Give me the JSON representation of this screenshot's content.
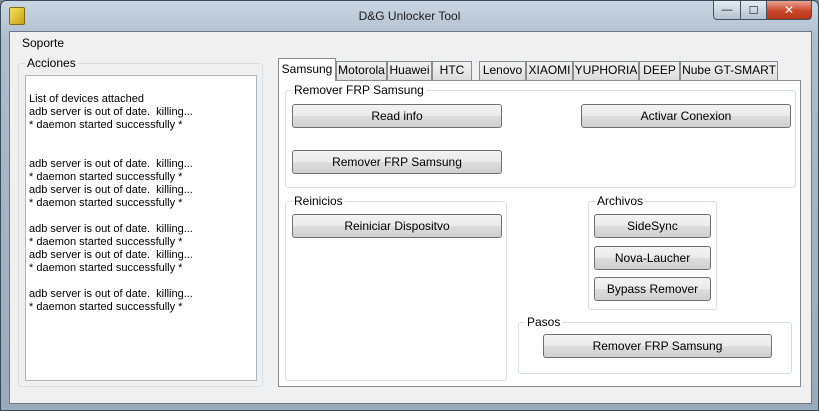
{
  "window": {
    "title": "D&G Unlocker Tool",
    "minimize": "—",
    "maximize": "☐",
    "close": "✕"
  },
  "menu": {
    "soporte": "Soporte"
  },
  "acciones": {
    "title": "Acciones",
    "log": "List of devices attached\nadb server is out of date.  killing...\n* daemon started successfully *\n\n\nadb server is out of date.  killing...\n* daemon started successfully *\nadb server is out of date.  killing...\n* daemon started successfully *\n\nadb server is out of date.  killing...\n* daemon started successfully *\nadb server is out of date.  killing...\n* daemon started successfully *\n\nadb server is out of date.  killing...\n* daemon started successfully *"
  },
  "tabs": [
    "Samsung",
    "Motorola",
    "Huawei",
    "HTC",
    "Lenovo",
    "XIAOMI",
    "YUPHORIA",
    "DEEP",
    "Nube GT-SMART"
  ],
  "samsung": {
    "remover_group": {
      "title": "Remover FRP Samsung",
      "read_info": "Read info",
      "activar": "Activar Conexion",
      "remover": "Remover FRP Samsung"
    },
    "reinicios": {
      "title": "Reinicios",
      "reiniciar": "Reiniciar Dispositvo"
    },
    "archivos": {
      "title": "Archivos",
      "sidesync": "SideSync",
      "nova": "Nova-Laucher",
      "bypass": "Bypass Remover"
    },
    "pasos": {
      "title": "Pasos",
      "remover": "Remover FRP Samsung"
    }
  }
}
